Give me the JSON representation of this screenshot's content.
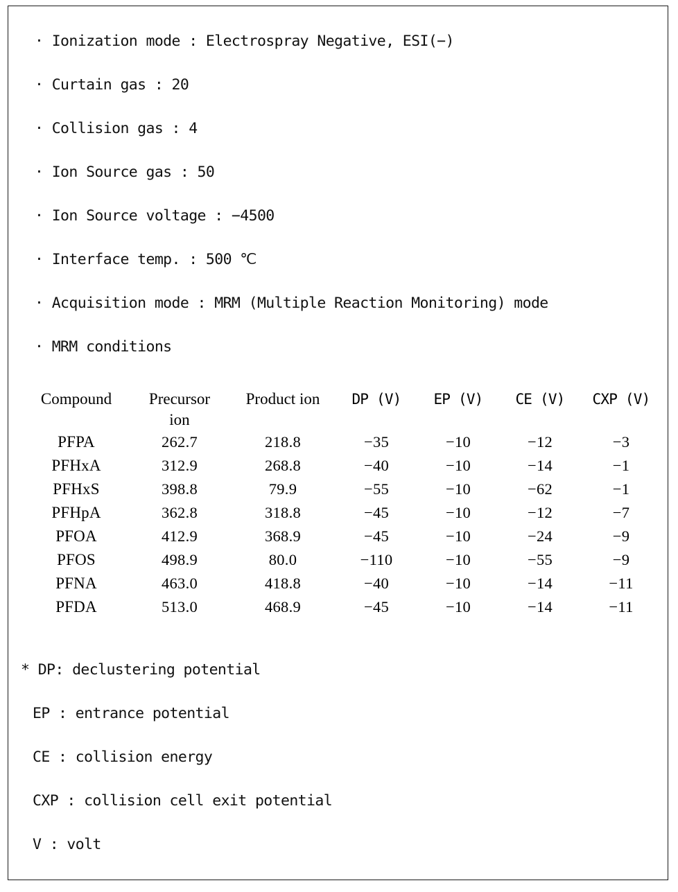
{
  "document": {
    "type": "lc-ms-ms-conditions-table",
    "bullet_marker": "·",
    "footnote_marker": "*"
  },
  "conditions": [
    {
      "label": "Ionization mode",
      "separator": ":",
      "value": "Electrospray Negative, ESI(−)",
      "text": "· Ionization mode : Electrospray Negative, ESI(−)"
    },
    {
      "label": "Curtain gas",
      "separator": ":",
      "value": "20",
      "text": "· Curtain gas : 20"
    },
    {
      "label": "Collision gas",
      "separator": ":",
      "value": "4",
      "text": "· Collision gas : 4"
    },
    {
      "label": "Ion Source gas",
      "separator": ":",
      "value": "50",
      "text": "· Ion Source gas : 50"
    },
    {
      "label": "Ion Source voltage",
      "separator": ":",
      "value": "−4500",
      "text": "· Ion Source voltage : −4500"
    },
    {
      "label": "Interface temp.",
      "separator": ":",
      "value": "500 ℃",
      "text": "· Interface temp. : 500 ℃"
    },
    {
      "label": "Acquisition mode",
      "separator": ":",
      "value": "MRM (Multiple Reaction Monitoring) mode",
      "text": "· Acquisition mode : MRM (Multiple Reaction Monitoring) mode"
    },
    {
      "label": "MRM conditions",
      "separator": "",
      "value": "",
      "text": "· MRM conditions"
    }
  ],
  "chart_data": {
    "type": "table",
    "title": "MRM conditions",
    "columns": [
      {
        "key": "compound",
        "header_line1": "Compound",
        "header_line2": ""
      },
      {
        "key": "precursor",
        "header_line1": "Precursor",
        "header_line2": "ion"
      },
      {
        "key": "product",
        "header_line1": "Product ion",
        "header_line2": ""
      },
      {
        "key": "dp",
        "header_line1": "DP (V)",
        "header_line2": ""
      },
      {
        "key": "ep",
        "header_line1": "EP (V)",
        "header_line2": ""
      },
      {
        "key": "ce",
        "header_line1": "CE (V)",
        "header_line2": ""
      },
      {
        "key": "cxp",
        "header_line1": "CXP (V)",
        "header_line2": ""
      }
    ],
    "rows": [
      {
        "compound": "PFPA",
        "precursor": "262.7",
        "product": "218.8",
        "dp": "−35",
        "ep": "−10",
        "ce": "−12",
        "cxp": "−3"
      },
      {
        "compound": "PFHxA",
        "precursor": "312.9",
        "product": "268.8",
        "dp": "−40",
        "ep": "−10",
        "ce": "−14",
        "cxp": "−1"
      },
      {
        "compound": "PFHxS",
        "precursor": "398.8",
        "product": "79.9",
        "dp": "−55",
        "ep": "−10",
        "ce": "−62",
        "cxp": "−1"
      },
      {
        "compound": "PFHpA",
        "precursor": "362.8",
        "product": "318.8",
        "dp": "−45",
        "ep": "−10",
        "ce": "−12",
        "cxp": "−7"
      },
      {
        "compound": "PFOA",
        "precursor": "412.9",
        "product": "368.9",
        "dp": "−45",
        "ep": "−10",
        "ce": "−24",
        "cxp": "−9"
      },
      {
        "compound": "PFOS",
        "precursor": "498.9",
        "product": "80.0",
        "dp": "−110",
        "ep": "−10",
        "ce": "−55",
        "cxp": "−9"
      },
      {
        "compound": "PFNA",
        "precursor": "463.0",
        "product": "418.8",
        "dp": "−40",
        "ep": "−10",
        "ce": "−14",
        "cxp": "−11"
      },
      {
        "compound": "PFDA",
        "precursor": "513.0",
        "product": "468.9",
        "dp": "−45",
        "ep": "−10",
        "ce": "−14",
        "cxp": "−11"
      }
    ]
  },
  "footnotes": [
    {
      "abbr": "DP",
      "definition": "declustering potential",
      "text": "* DP: declustering potential"
    },
    {
      "abbr": "EP",
      "definition": "entrance potential",
      "text": "EP : entrance potential"
    },
    {
      "abbr": "CE",
      "definition": "collision energy",
      "text": "CE : collision energy"
    },
    {
      "abbr": "CXP",
      "definition": "collision cell exit potential",
      "text": "CXP : collision cell exit potential"
    },
    {
      "abbr": "V",
      "definition": "volt",
      "text": "V : volt"
    }
  ],
  "colors": {
    "border": "#1a1a1a",
    "text": "#111111",
    "background": "#ffffff"
  }
}
